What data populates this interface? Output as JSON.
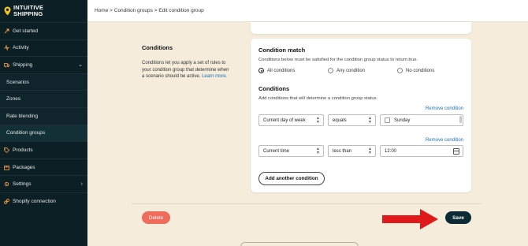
{
  "brand": {
    "line1": "INTUITIVE",
    "line2": "SHIPPING"
  },
  "sidebar": {
    "items": [
      {
        "label": "Get started",
        "icon": "rocket-icon"
      },
      {
        "label": "Activity",
        "icon": "activity-icon"
      },
      {
        "label": "Shipping",
        "icon": "truck-icon"
      },
      {
        "label": "Scenarios"
      },
      {
        "label": "Zones"
      },
      {
        "label": "Rate blending"
      },
      {
        "label": "Condition groups"
      },
      {
        "label": "Products",
        "icon": "tag-icon"
      },
      {
        "label": "Packages",
        "icon": "package-icon"
      },
      {
        "label": "Settings",
        "icon": "gear-icon"
      },
      {
        "label": "Shopify connection",
        "icon": "link-icon"
      }
    ]
  },
  "breadcrumb": {
    "text": "Home > Condition groups > Edit condition group"
  },
  "section": {
    "title": "Conditions",
    "description": "Conditions let you apply a set of rules to your condition group that determine when a scenario should be active.",
    "learn_more": "Learn more."
  },
  "condition_match": {
    "title": "Condition match",
    "description": "Conditions below must be satisfied for the condition group status to return true.",
    "options": [
      "All conditions",
      "Any condition",
      "No conditions"
    ],
    "selected": "All conditions"
  },
  "conditions": {
    "title": "Conditions",
    "description": "Add conditions that will determine a condition group status.",
    "remove_label": "Remove condition",
    "rows": [
      {
        "field": "Current day of week",
        "operator": "equals",
        "value": "Sunday"
      },
      {
        "field": "Current time",
        "operator": "less than",
        "value": "12:00"
      }
    ],
    "add_label": "Add another condition"
  },
  "actions": {
    "delete_label": "Delete",
    "save_label": "Save"
  },
  "colors": {
    "accent_orange": "#f4a14f",
    "delete_red": "#ef6b5c",
    "save_dark": "#0d2b34",
    "link_blue": "#1a73b8",
    "arrow_red": "#e0191b"
  }
}
